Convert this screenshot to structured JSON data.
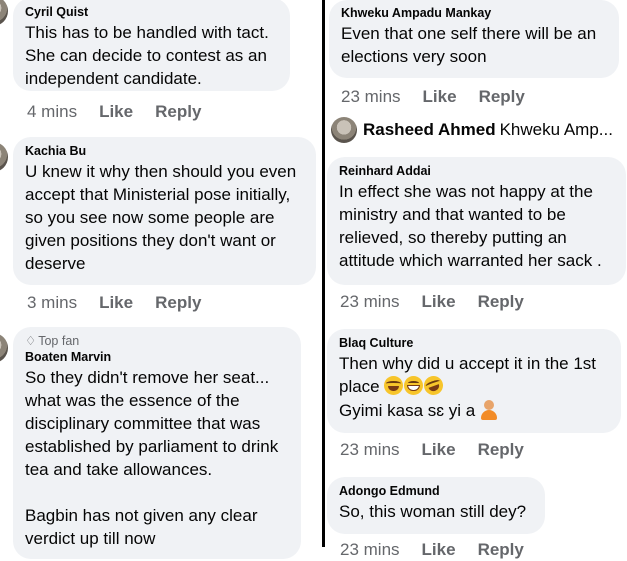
{
  "left_column": {
    "comments": [
      {
        "author": "Cyril Quist",
        "text": "This has to be handled with tact. She can decide to contest as an independent candidate.",
        "time": "4 mins",
        "like": "Like",
        "reply": "Reply"
      },
      {
        "author": "Kachia Bu",
        "text": "U knew it why then should you even accept that Ministerial pose initially, so you see now some people are given positions they don't want or deserve",
        "time": "3 mins",
        "like": "Like",
        "reply": "Reply"
      },
      {
        "badge": "Top fan",
        "author": "Boaten Marvin",
        "text": "So they didn't remove her seat... what was the essence of the disciplinary committee that was established by parliament to drink tea and take allowances.",
        "text2": "Bagbin has not given any clear verdict up till now"
      }
    ]
  },
  "right_column": {
    "comments": [
      {
        "author": "Khweku Ampadu Mankay",
        "text": "Even that one self there will be an elections very soon",
        "time": "23 mins",
        "like": "Like",
        "reply": "Reply"
      },
      {
        "author": "Reinhard Addai",
        "text": "In effect she was not happy at the ministry and that wanted to be relieved, so thereby putting an attitude which warranted her sack .",
        "time": "23 mins",
        "like": "Like",
        "reply": "Reply"
      },
      {
        "author": "Blaq Culture",
        "text": "Then why did u accept it in the 1st place",
        "text2": "Gyimi kasa sɛ yi a",
        "time": "23 mins",
        "like": "Like",
        "reply": "Reply"
      },
      {
        "author": "Adongo Edmund",
        "text": "So, this woman still dey?",
        "time": "23 mins",
        "like": "Like",
        "reply": "Reply"
      }
    ],
    "reply_preview": {
      "author": "Rasheed Ahmed",
      "snippet": "Khweku Amp..."
    }
  },
  "icons": {
    "emoji_1": "laughing-face-icon",
    "emoji_2": "grinning-face-icon",
    "emoji_3": "rolling-laughing-face-icon",
    "emoji_4": "person-gesturing-icon",
    "badge": "gem-icon"
  }
}
